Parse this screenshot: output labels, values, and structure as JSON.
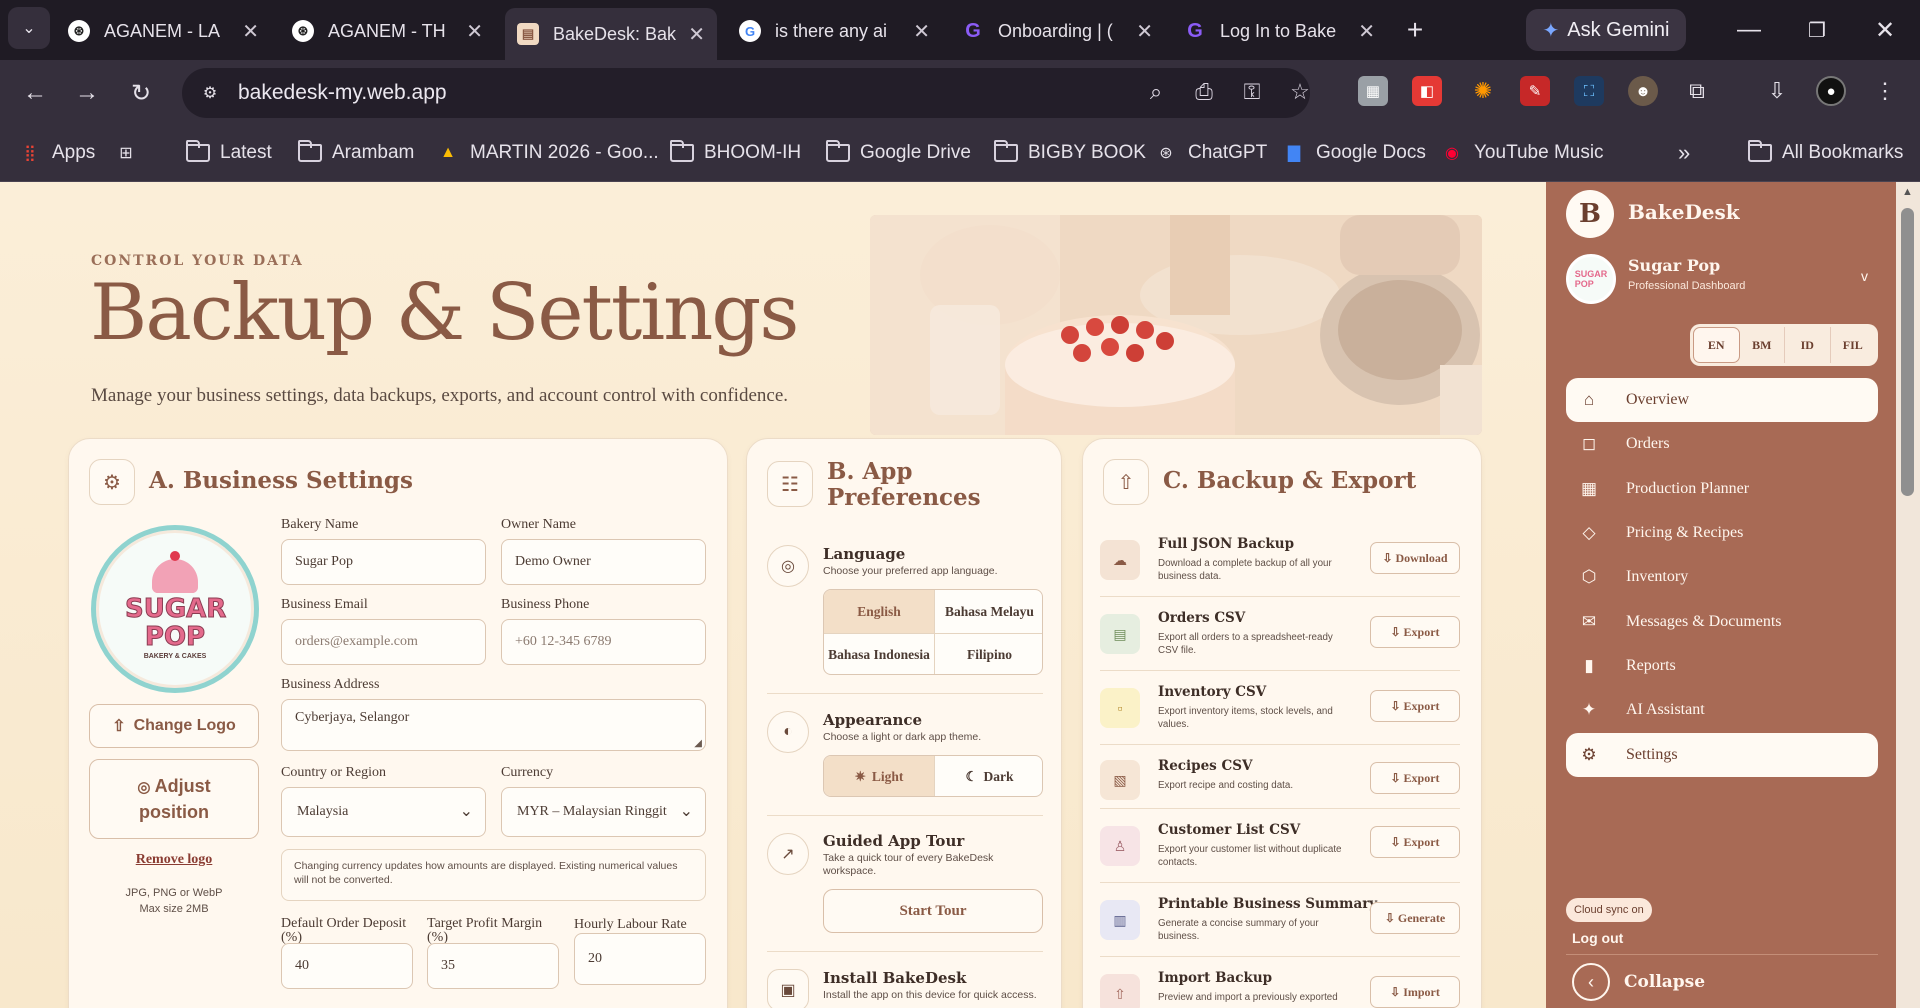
{
  "browser": {
    "tabs": [
      {
        "title": "AGANEM - LA",
        "icon": "chatgpt-icon"
      },
      {
        "title": "AGANEM - TH",
        "icon": "chatgpt-icon"
      },
      {
        "title": "BakeDesk: Bak",
        "icon": "bakedesk-icon"
      },
      {
        "title": "is there any ai",
        "icon": "google-icon"
      },
      {
        "title": "Onboarding | (",
        "icon": "onboarding-icon"
      },
      {
        "title": "Log In to Bake",
        "icon": "login-icon"
      }
    ],
    "ask_gemini": "Ask Gemini",
    "url": "bakedesk-my.web.app",
    "bookmarks": [
      "Apps",
      "Latest",
      "Arambam",
      "MARTIN 2026 - Goo...",
      "BHOOM-IH",
      "Google Drive",
      "BIGBY BOOK",
      "ChatGPT",
      "Google Docs",
      "YouTube Music"
    ],
    "all_bookmarks": "All Bookmarks"
  },
  "hero": {
    "eyebrow": "CONTROL YOUR DATA",
    "title": "Backup & Settings",
    "subtitle": "Manage your business settings, data backups, exports, and account control with confidence."
  },
  "business": {
    "title": "A. Business Settings",
    "logo_text": "SUGAR POP",
    "logo_sub": "BAKERY & CAKES",
    "change_logo": "Change Logo",
    "adjust_position": "Adjust position",
    "remove_logo": "Remove logo",
    "logo_hint": "JPG, PNG or WebP",
    "logo_size": "Max size 2MB",
    "bakery_name_label": "Bakery Name",
    "bakery_name": "Sugar Pop",
    "owner_name_label": "Owner Name",
    "owner_name": "Demo Owner",
    "email_label": "Business Email",
    "email_placeholder": "orders@example.com",
    "phone_label": "Business Phone",
    "phone_placeholder": "+60 12-345 6789",
    "address_label": "Business Address",
    "address": "Cyberjaya, Selangor",
    "country_label": "Country or Region",
    "country": "Malaysia",
    "currency_label": "Currency",
    "currency": "MYR – Malaysian Ringgit",
    "currency_note": "Changing currency updates how amounts are displayed. Existing numerical values will not be converted.",
    "deposit_label": "Default Order Deposit (%)",
    "deposit": "40",
    "margin_label": "Target Profit Margin (%)",
    "margin": "35",
    "labour_label": "Hourly Labour Rate",
    "labour": "20"
  },
  "prefs": {
    "title_l1": "B. App",
    "title_l2": "Preferences",
    "language_title": "Language",
    "language_desc": "Choose your preferred app language.",
    "languages": [
      "English",
      "Bahasa Melayu",
      "Bahasa Indonesia",
      "Filipino"
    ],
    "language_selected": "English",
    "appearance_title": "Appearance",
    "appearance_desc": "Choose a light or dark app theme.",
    "light": "Light",
    "dark": "Dark",
    "tour_title": "Guided App Tour",
    "tour_desc": "Take a quick tour of every BakeDesk workspace.",
    "start_tour": "Start Tour",
    "install_title": "Install BakeDesk",
    "install_desc": "Install the app on this device for quick access."
  },
  "backup": {
    "title": "C. Backup & Export",
    "rows": [
      {
        "title": "Full JSON Backup",
        "desc": "Download a complete backup of all your business data.",
        "button": "⇩ Download"
      },
      {
        "title": "Orders CSV",
        "desc": "Export all orders to a spreadsheet-ready CSV file.",
        "button": "⇩ Export"
      },
      {
        "title": "Inventory CSV",
        "desc": "Export inventory items, stock levels, and values.",
        "button": "⇩ Export"
      },
      {
        "title": "Recipes CSV",
        "desc": "Export recipe and costing data.",
        "button": "⇩ Export"
      },
      {
        "title": "Customer List CSV",
        "desc": "Export your customer list without duplicate contacts.",
        "button": "⇩ Export"
      },
      {
        "title": "Printable Business Summary",
        "desc": "Generate a concise summary of your business.",
        "button": "⇩ Generate"
      },
      {
        "title": "Import Backup",
        "desc": "Preview and import a previously exported",
        "button": "⇩ Import"
      }
    ]
  },
  "sidebar": {
    "brand_initial": "B",
    "brand": "BakeDesk",
    "account_name": "Sugar Pop",
    "account_sub": "Professional Dashboard",
    "langs": [
      "EN",
      "BM",
      "ID",
      "FIL"
    ],
    "items": [
      {
        "label": "Overview",
        "icon": "home-icon"
      },
      {
        "label": "Orders",
        "icon": "bag-icon"
      },
      {
        "label": "Production Planner",
        "icon": "calendar-icon"
      },
      {
        "label": "Pricing & Recipes",
        "icon": "tag-icon"
      },
      {
        "label": "Inventory",
        "icon": "box-icon"
      },
      {
        "label": "Messages & Documents",
        "icon": "mail-icon"
      },
      {
        "label": "Reports",
        "icon": "bar-chart-icon"
      },
      {
        "label": "AI Assistant",
        "icon": "sparkle-icon"
      },
      {
        "label": "Settings",
        "icon": "gear-icon"
      }
    ],
    "cloud_sync": "Cloud sync on",
    "logout": "Log out",
    "collapse": "Collapse"
  }
}
